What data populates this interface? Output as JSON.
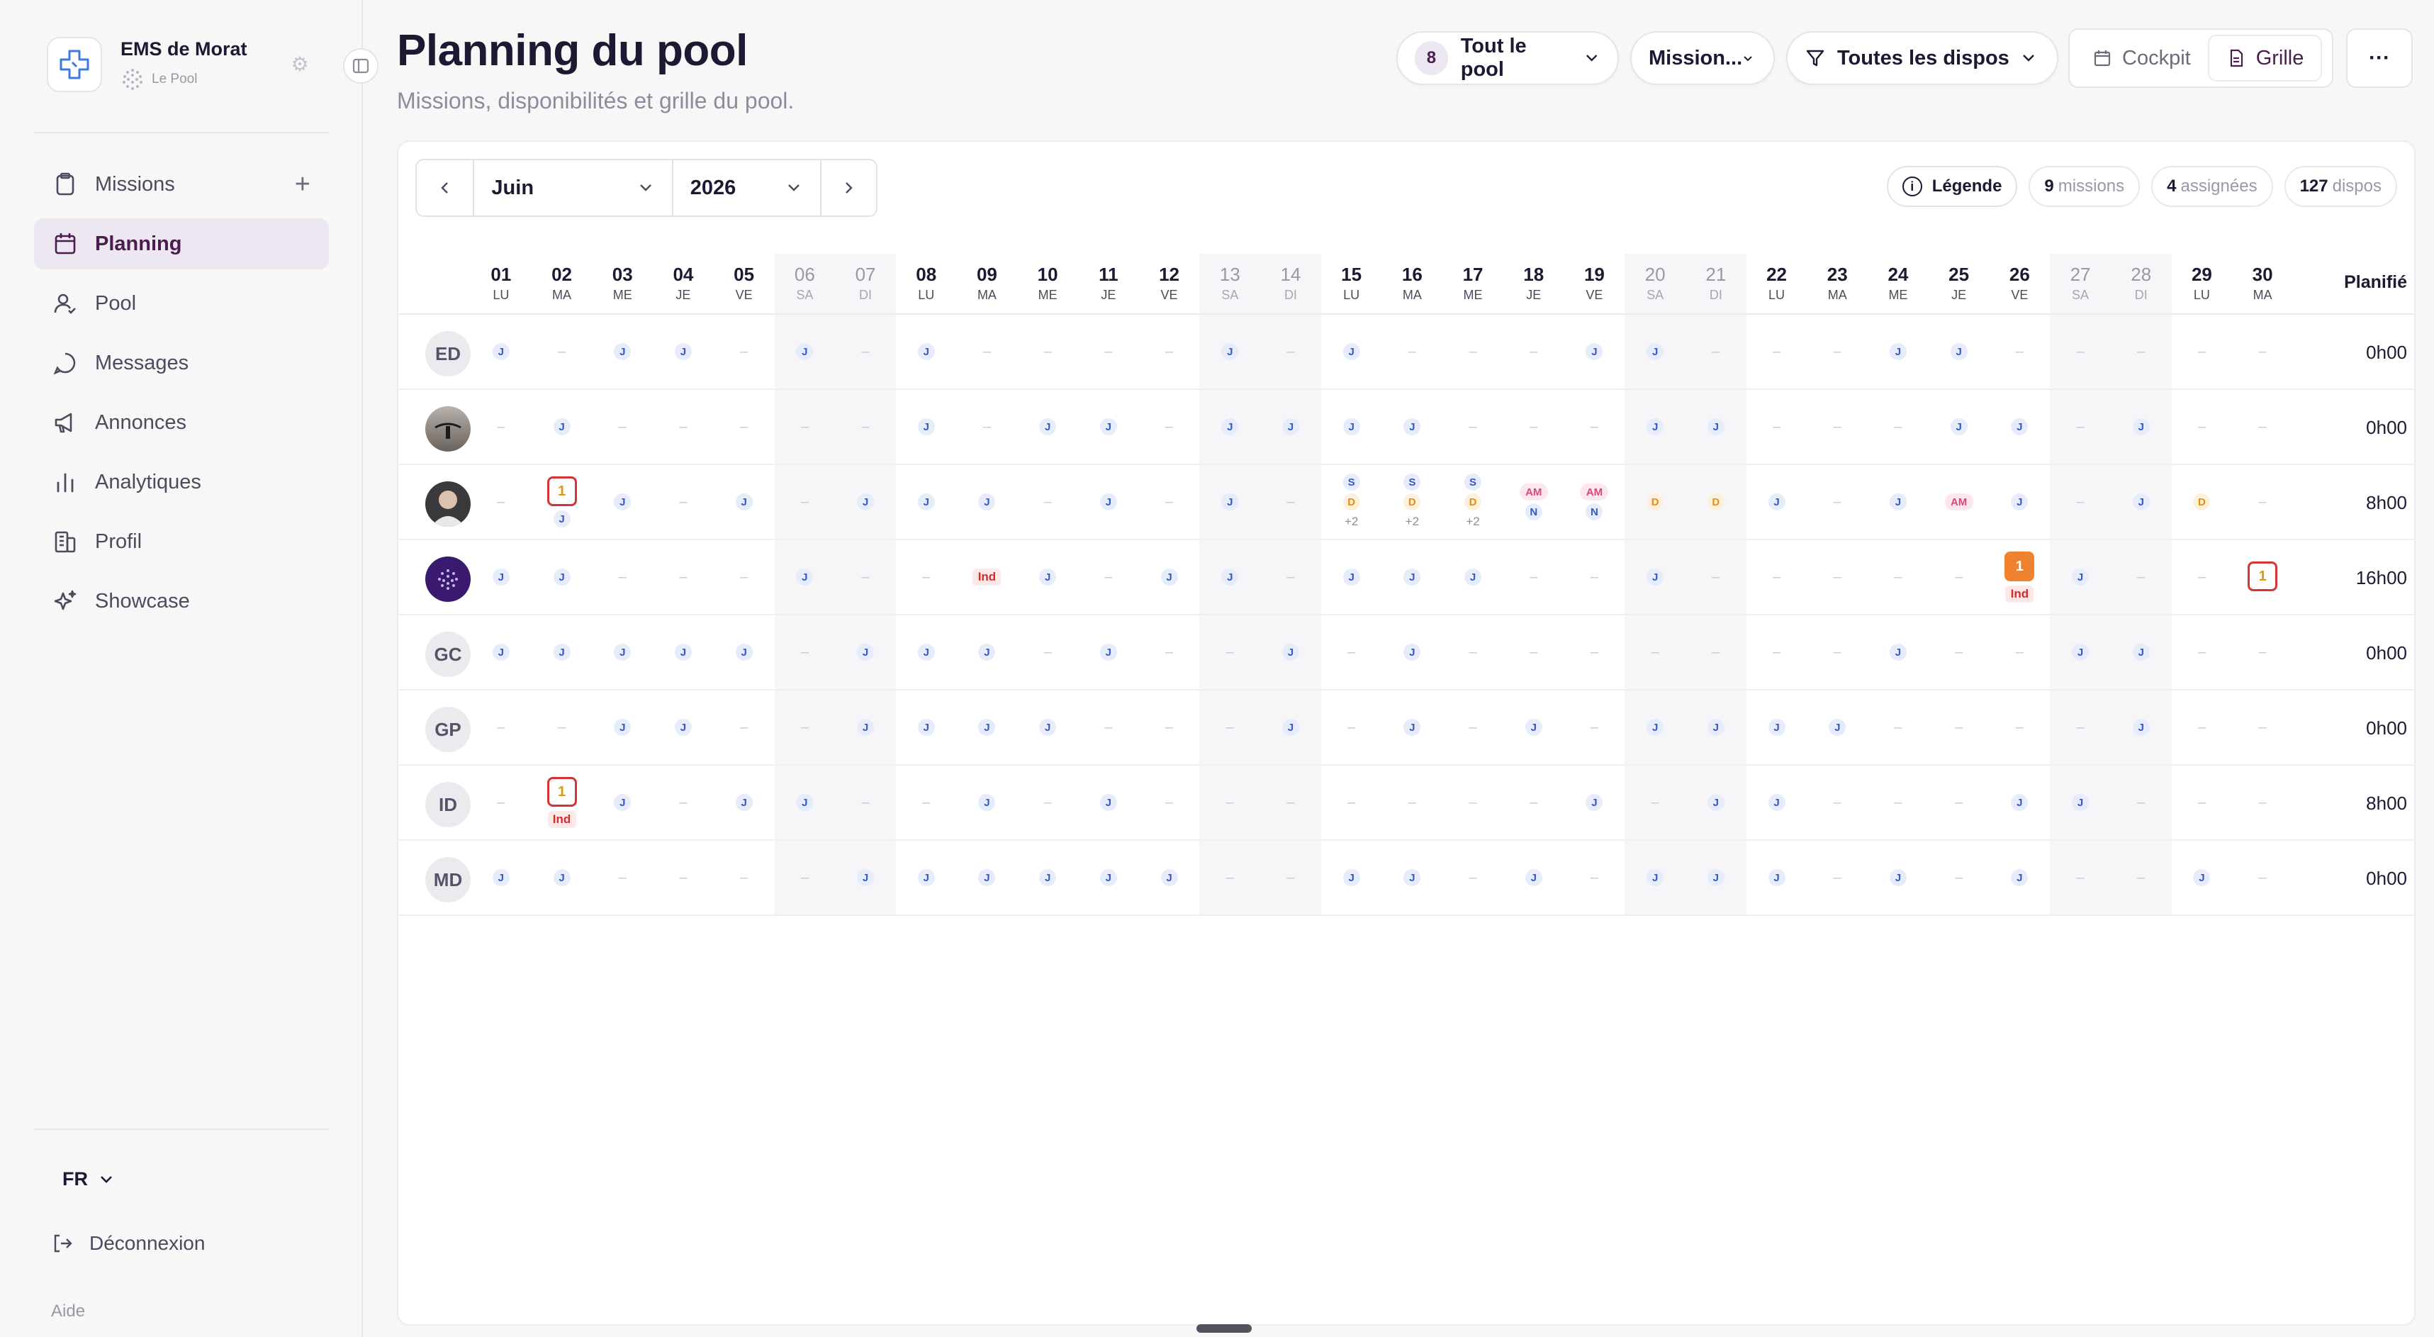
{
  "org": {
    "name": "EMS de Morat",
    "subtitle": "Le Pool"
  },
  "nav": {
    "items": [
      {
        "label": "Missions",
        "icon": "clipboard-icon"
      },
      {
        "label": "Planning",
        "icon": "calendar-icon"
      },
      {
        "label": "Pool",
        "icon": "user-icon"
      },
      {
        "label": "Messages",
        "icon": "message-icon"
      },
      {
        "label": "Annonces",
        "icon": "megaphone-icon"
      },
      {
        "label": "Analytiques",
        "icon": "bar-chart-icon"
      },
      {
        "label": "Profil",
        "icon": "building-icon"
      },
      {
        "label": "Showcase",
        "icon": "sparkles-icon"
      }
    ],
    "active": "Planning"
  },
  "sidebar_footer": {
    "language": "FR",
    "logout": "Déconnexion",
    "help": "Aide"
  },
  "header": {
    "title": "Planning du pool",
    "subtitle": "Missions, disponibilités et grille du pool.",
    "pool_filter": {
      "count": "8",
      "label": "Tout le pool"
    },
    "mission_filter": "Mission...",
    "dispo_filter": "Toutes les dispos",
    "views": {
      "cockpit": "Cockpit",
      "grid": "Grille"
    },
    "more": "···"
  },
  "toolbar": {
    "month": "Juin",
    "year": "2026",
    "legend": "Légende",
    "stats": [
      {
        "value": "9",
        "label": "missions"
      },
      {
        "value": "4",
        "label": "assignées"
      },
      {
        "value": "127",
        "label": "dispos"
      }
    ]
  },
  "grid": {
    "planned_header": "Planifié",
    "days": [
      {
        "n": "01",
        "d": "LU"
      },
      {
        "n": "02",
        "d": "MA"
      },
      {
        "n": "03",
        "d": "ME"
      },
      {
        "n": "04",
        "d": "JE"
      },
      {
        "n": "05",
        "d": "VE"
      },
      {
        "n": "06",
        "d": "SA",
        "we": true
      },
      {
        "n": "07",
        "d": "DI",
        "we": true
      },
      {
        "n": "08",
        "d": "LU"
      },
      {
        "n": "09",
        "d": "MA"
      },
      {
        "n": "10",
        "d": "ME"
      },
      {
        "n": "11",
        "d": "JE"
      },
      {
        "n": "12",
        "d": "VE"
      },
      {
        "n": "13",
        "d": "SA",
        "we": true
      },
      {
        "n": "14",
        "d": "DI",
        "we": true
      },
      {
        "n": "15",
        "d": "LU"
      },
      {
        "n": "16",
        "d": "MA"
      },
      {
        "n": "17",
        "d": "ME"
      },
      {
        "n": "18",
        "d": "JE"
      },
      {
        "n": "19",
        "d": "VE"
      },
      {
        "n": "20",
        "d": "SA",
        "we": true
      },
      {
        "n": "21",
        "d": "DI",
        "we": true
      },
      {
        "n": "22",
        "d": "LU"
      },
      {
        "n": "23",
        "d": "MA"
      },
      {
        "n": "24",
        "d": "ME"
      },
      {
        "n": "25",
        "d": "JE"
      },
      {
        "n": "26",
        "d": "VE"
      },
      {
        "n": "27",
        "d": "SA",
        "we": true
      },
      {
        "n": "28",
        "d": "DI",
        "we": true
      },
      {
        "n": "29",
        "d": "LU"
      },
      {
        "n": "30",
        "d": "MA"
      }
    ],
    "rows": [
      {
        "initials": "ED",
        "avatar": "initials",
        "planned": "0h00",
        "cells": [
          "J",
          "",
          "J",
          "J",
          "",
          "J",
          "",
          "J",
          "",
          "",
          "",
          "",
          "J",
          "",
          "J",
          "",
          "",
          "",
          "J",
          "J",
          "",
          "",
          "",
          "J",
          "J",
          "",
          "",
          "",
          "",
          ""
        ]
      },
      {
        "initials": "",
        "avatar": "photo-1",
        "planned": "0h00",
        "cells": [
          "",
          "J",
          "",
          "",
          "",
          "",
          "",
          "J",
          "",
          "J",
          "J",
          "",
          "J",
          "J",
          "J",
          "J",
          "",
          "",
          "",
          "J",
          "J",
          "",
          "",
          "",
          "J",
          "J",
          "",
          "J",
          "",
          ""
        ]
      },
      {
        "initials": "",
        "avatar": "photo-2",
        "planned": "8h00",
        "cells": [
          "",
          "box1|J",
          "J",
          "",
          "J",
          "",
          "J",
          "J",
          "J",
          "",
          "J",
          "",
          "J",
          "",
          "S|D|+2",
          "S|D|+2",
          "S|D|+2",
          "AM|N",
          "AM|N",
          "D",
          "D",
          "J",
          "",
          "J",
          "AM",
          "J",
          "",
          "J",
          "D",
          ""
        ]
      },
      {
        "initials": "",
        "avatar": "logo",
        "planned": "16h00",
        "cells": [
          "J",
          "J",
          "",
          "",
          "",
          "J",
          "",
          "",
          "Ind",
          "J",
          "",
          "J",
          "J",
          "",
          "J",
          "J",
          "J",
          "",
          "",
          "J",
          "",
          "",
          "",
          "",
          "",
          "orange1|Ind",
          "J",
          "",
          "",
          "box1"
        ]
      },
      {
        "initials": "GC",
        "avatar": "initials",
        "planned": "0h00",
        "cells": [
          "J",
          "J",
          "J",
          "J",
          "J",
          "",
          "J",
          "J",
          "J",
          "",
          "J",
          "",
          "",
          "J",
          "",
          "J",
          "",
          "",
          "",
          "",
          "",
          "",
          "",
          "J",
          "",
          "",
          "J",
          "J",
          "",
          ""
        ]
      },
      {
        "initials": "GP",
        "avatar": "initials",
        "planned": "0h00",
        "cells": [
          "",
          "",
          "J",
          "J",
          "",
          "",
          "J",
          "J",
          "J",
          "J",
          "",
          "",
          "",
          "J",
          "",
          "J",
          "",
          "J",
          "",
          "J",
          "J",
          "J",
          "J",
          "",
          "",
          "",
          "",
          "J",
          "",
          ""
        ]
      },
      {
        "initials": "ID",
        "avatar": "initials",
        "planned": "8h00",
        "cells": [
          "",
          "box1|Ind",
          "J",
          "",
          "J",
          "J",
          "",
          "",
          "J",
          "",
          "J",
          "",
          "",
          "",
          "",
          "",
          "",
          "",
          "J",
          "",
          "J",
          "J",
          "",
          "",
          "",
          "J",
          "J",
          "",
          "",
          ""
        ]
      },
      {
        "initials": "MD",
        "avatar": "initials",
        "planned": "0h00",
        "cells": [
          "J",
          "J",
          "",
          "",
          "",
          "",
          "J",
          "J",
          "J",
          "J",
          "J",
          "J",
          "",
          "",
          "J",
          "J",
          "",
          "J",
          "",
          "J",
          "J",
          "J",
          "",
          "J",
          "",
          "J",
          "",
          "",
          "J",
          ""
        ]
      }
    ]
  },
  "colors": {
    "accent": "#4a1d4e",
    "active_bg": "#ece7f1",
    "orange": "#f0812f",
    "red": "#d63434"
  }
}
